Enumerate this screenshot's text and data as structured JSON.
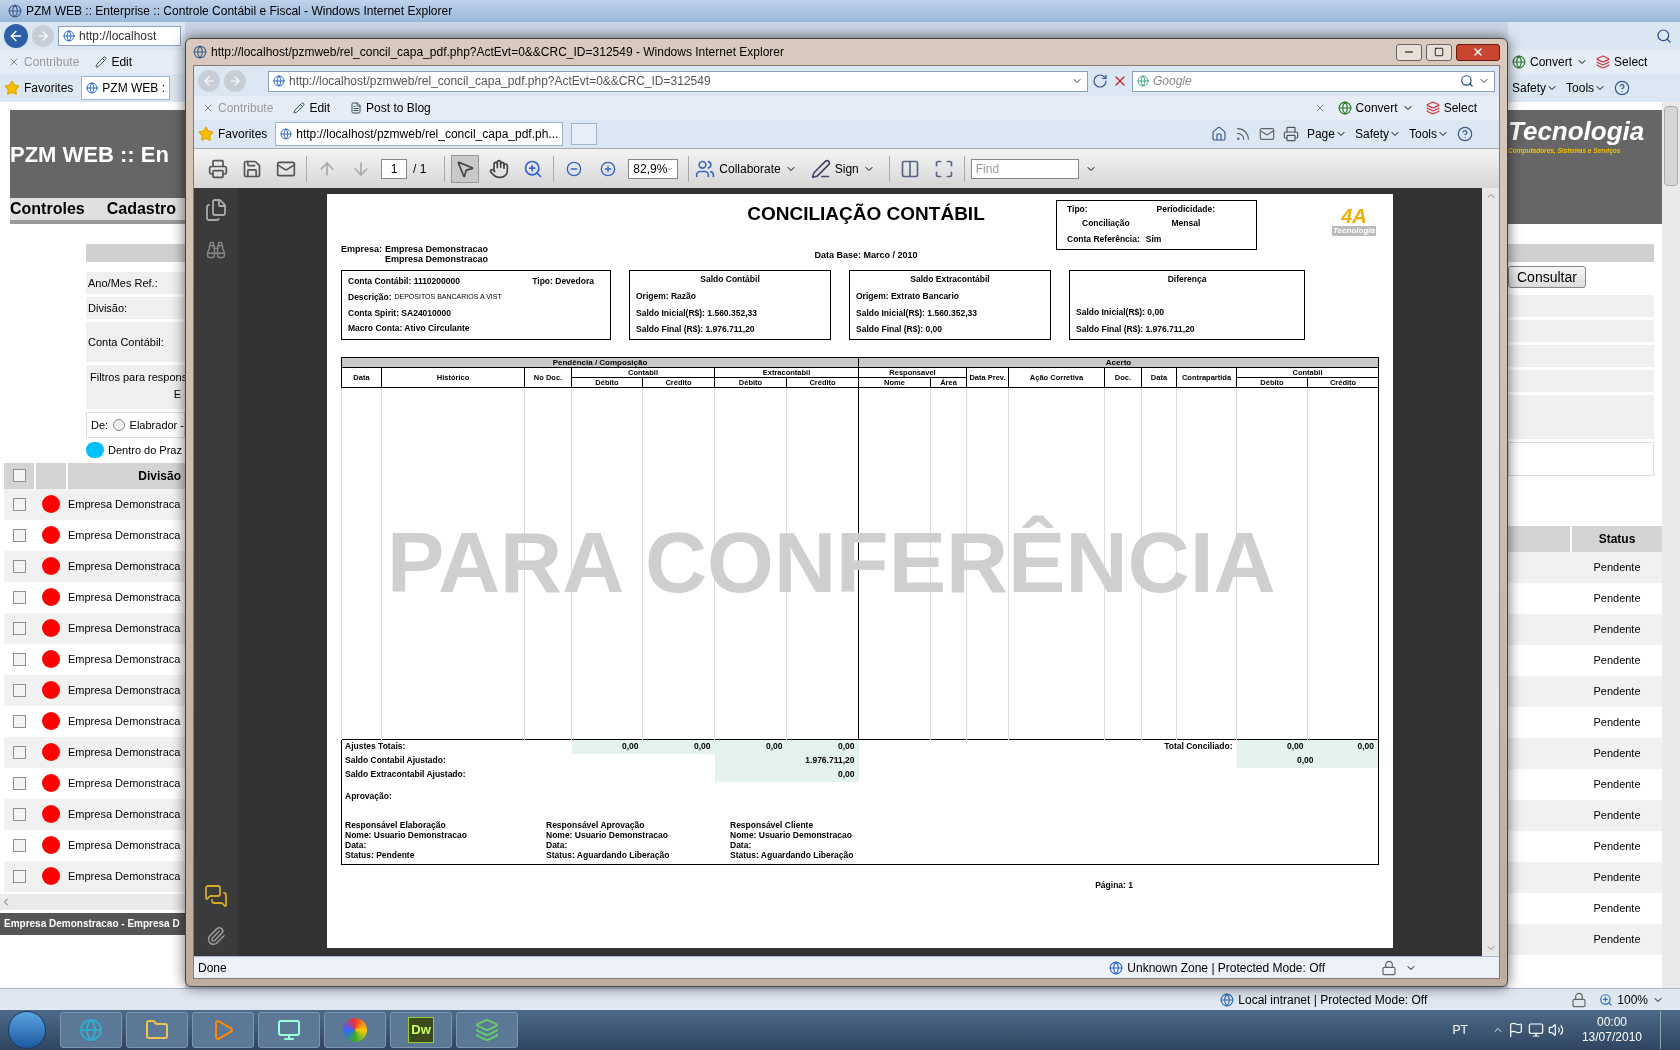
{
  "desktop_window": {
    "title": "PZM WEB :: Enterprise :: Controle Contábil e Fiscal - Windows Internet Explorer",
    "address": "http://localhost",
    "command_left": [
      {
        "label": "Contribute",
        "disabled": true
      },
      {
        "label": "Edit",
        "disabled": false
      }
    ],
    "command_right": [
      "Convert",
      "Select"
    ],
    "favorites": "Favorites",
    "tab": {
      "label": "PZM WEB :",
      "selected": true
    },
    "tools_right": [
      "Safety",
      "Tools"
    ],
    "site_title": "PZM WEB :: En",
    "logo": {
      "name": "Tecnologia",
      "tagline": "Computadores, Sistemas e Serviços"
    },
    "menu": [
      "Controles",
      "Cadastro"
    ],
    "filter_labels": [
      "Ano/Mes Ref.:",
      "Divisão:",
      "Conta Contábil:"
    ],
    "filter_note": [
      "Filtros para respons",
      "E"
    ],
    "radio": {
      "prefix": "De:",
      "label": "Elabrador -",
      "selected": false
    },
    "legend": {
      "label": "Dentro do Praz",
      "color": "#00bfff"
    },
    "consult_button": "Consultar",
    "table": {
      "columns": [
        "Divisão",
        "Status"
      ],
      "header_checked": false,
      "rows": [
        {
          "division": "Empresa Demonstraca",
          "status": "Pendente",
          "checked": false,
          "color": "#ff0000"
        },
        {
          "division": "Empresa Demonstraca",
          "status": "Pendente",
          "checked": false,
          "color": "#ff0000"
        },
        {
          "division": "Empresa Demonstraca",
          "status": "Pendente",
          "checked": false,
          "color": "#ff0000"
        },
        {
          "division": "Empresa Demonstraca",
          "status": "Pendente",
          "checked": false,
          "color": "#ff0000"
        },
        {
          "division": "Empresa Demonstraca",
          "status": "Pendente",
          "checked": false,
          "color": "#ff0000"
        },
        {
          "division": "Empresa Demonstraca",
          "status": "Pendente",
          "checked": false,
          "color": "#ff0000"
        },
        {
          "division": "Empresa Demonstraca",
          "status": "Pendente",
          "checked": false,
          "color": "#ff0000"
        },
        {
          "division": "Empresa Demonstraca",
          "status": "Pendente",
          "checked": false,
          "color": "#ff0000"
        },
        {
          "division": "Empresa Demonstraca",
          "status": "Pendente",
          "checked": false,
          "color": "#ff0000"
        },
        {
          "division": "Empresa Demonstraca",
          "status": "Pendente",
          "checked": false,
          "color": "#ff0000"
        },
        {
          "division": "Empresa Demonstraca",
          "status": "Pendente",
          "checked": false,
          "color": "#ff0000"
        },
        {
          "division": "Empresa Demonstraca",
          "status": "Pendente",
          "checked": false,
          "color": "#ff0000"
        },
        {
          "division": "Empresa Demonstraca",
          "status": "Pendente",
          "checked": false,
          "color": "#ff0000"
        }
      ]
    },
    "footer": "Empresa Demonstracao - Empresa D",
    "status_zone": "Local intranet | Protected Mode: Off",
    "zoom": "100%"
  },
  "popup_window": {
    "title": "http://localhost/pzmweb/rel_concil_capa_pdf.php?ActEvt=0&&CRC_ID=312549 - Windows Internet Explorer",
    "address": "http://localhost/pzmweb/rel_concil_capa_pdf.php?ActEvt=0&&CRC_ID=312549",
    "search_placeholder": "Google",
    "command_left": [
      {
        "label": "Contribute",
        "disabled": true
      },
      {
        "label": "Edit",
        "disabled": false
      },
      {
        "label": "Post to Blog",
        "disabled": false
      }
    ],
    "command_right": [
      "Convert",
      "Select"
    ],
    "favorites": "Favorites",
    "tab": {
      "label": "http://localhost/pzmweb/rel_concil_capa_pdf.ph...",
      "selected": true
    },
    "tools_right": [
      "Page",
      "Safety",
      "Tools"
    ],
    "pdf_toolbar": {
      "page": "1",
      "page_count": "/ 1",
      "zoom": "82,9%",
      "collaborate": "Collaborate",
      "sign": "Sign",
      "find_placeholder": "Find"
    },
    "document": {
      "title": "CONCILIAÇÃO CONTÁBIL",
      "company_label": "Empresa:",
      "companies": [
        "Empresa Demonstracao",
        "Empresa Demonstracao"
      ],
      "base_date": "Data Base: Marco / 2010",
      "info_box": {
        "type_label": "Tipo:",
        "type": "Conciliação",
        "period_label": "Periodicidade:",
        "period": "Mensal",
        "reference_label": "Conta Referência:",
        "reference": "Sim"
      },
      "logo": {
        "mark": "4A",
        "name": "Tecnologia"
      },
      "account": {
        "conta": "Conta Contábil: 1110200000",
        "tipo": "Tipo: Devedora",
        "description_label": "Descrição:",
        "description": "DEPOSITOS BANCARIOS A VIST",
        "spirit": "Conta Spirit: SA24010000",
        "macro": "Macro Conta: Ativo Circulante"
      },
      "balances": [
        {
          "title": "Saldo Contábil",
          "origin": "Origem: Razão",
          "initial": "Saldo Inicial(R$): 1.560.352,33",
          "final": "Saldo Final (R$): 1.976.711,20"
        },
        {
          "title": "Saldo Extracontábil",
          "origin": "Origem: Extrato Bancario",
          "initial": "Saldo Inicial(R$): 1.560.352,33",
          "final": "Saldo Final (R$): 0,00"
        },
        {
          "title": "Diferença",
          "initial": "Saldo Inicial(R$): 0,00",
          "final": "Saldo Final (R$): 1.976.711,20"
        }
      ],
      "table": {
        "groups": [
          "Pendência / Composição",
          "Acerto"
        ],
        "left_columns": [
          {
            "label": "Data"
          },
          {
            "label": "Histórico"
          },
          {
            "label": "No Doc."
          },
          {
            "label": "Contabil",
            "sub": [
              "Débito",
              "Crédito"
            ]
          },
          {
            "label": "Extracontabil",
            "sub": [
              "Débito",
              "Crédito"
            ]
          }
        ],
        "right_columns": [
          {
            "label": "Responsavel",
            "sub": [
              "Nome",
              "Área"
            ]
          },
          {
            "label": "Data Prev."
          },
          {
            "label": "Ação Corretiva"
          },
          {
            "label": "Doc."
          },
          {
            "label": "Data"
          },
          {
            "label": "Contrapartida"
          },
          {
            "label": "Contabil",
            "sub": [
              "Débito",
              "Crédito"
            ]
          }
        ]
      },
      "totals": {
        "adjust_label": "Ajustes Totais:",
        "adjust_values": [
          "0,00",
          "0,00",
          "0,00",
          "0,00"
        ],
        "reconciled_label": "Total Conciliado:",
        "reconciled_values": [
          "0,00",
          "0,00"
        ],
        "accounting_label": "Saldo Contabil Ajustado:",
        "accounting_value": "1.976.711,20",
        "reconciled_total": "0,00",
        "extra_label": "Saldo Extracontabil Ajustado:",
        "extra_value": "0,00"
      },
      "approval": {
        "label": "Aprovação:",
        "signers": [
          {
            "role": "Responsável Elaboração",
            "name": "Nome: Usuario Demonstracao",
            "date": "Data:",
            "status": "Status: Pendente"
          },
          {
            "role": "Responsável Aprovação",
            "name": "Nome: Usuario Demonstracao",
            "date": "Data:",
            "status": "Status: Aguardando Liberação"
          },
          {
            "role": "Responsável Cliente",
            "name": "Nome: Usuario Demonstracao",
            "date": "Data:",
            "status": "Status: Aguardando Liberação"
          }
        ]
      },
      "page_label": "Página: 1",
      "watermark": "PARA CONFERÊNCIA"
    },
    "status": "Done",
    "status_zone": "Unknown Zone | Protected Mode: Off"
  },
  "taskbar": {
    "app_label": "Dw",
    "language": "PT",
    "time": "00:00",
    "date": "13/07/2010"
  }
}
